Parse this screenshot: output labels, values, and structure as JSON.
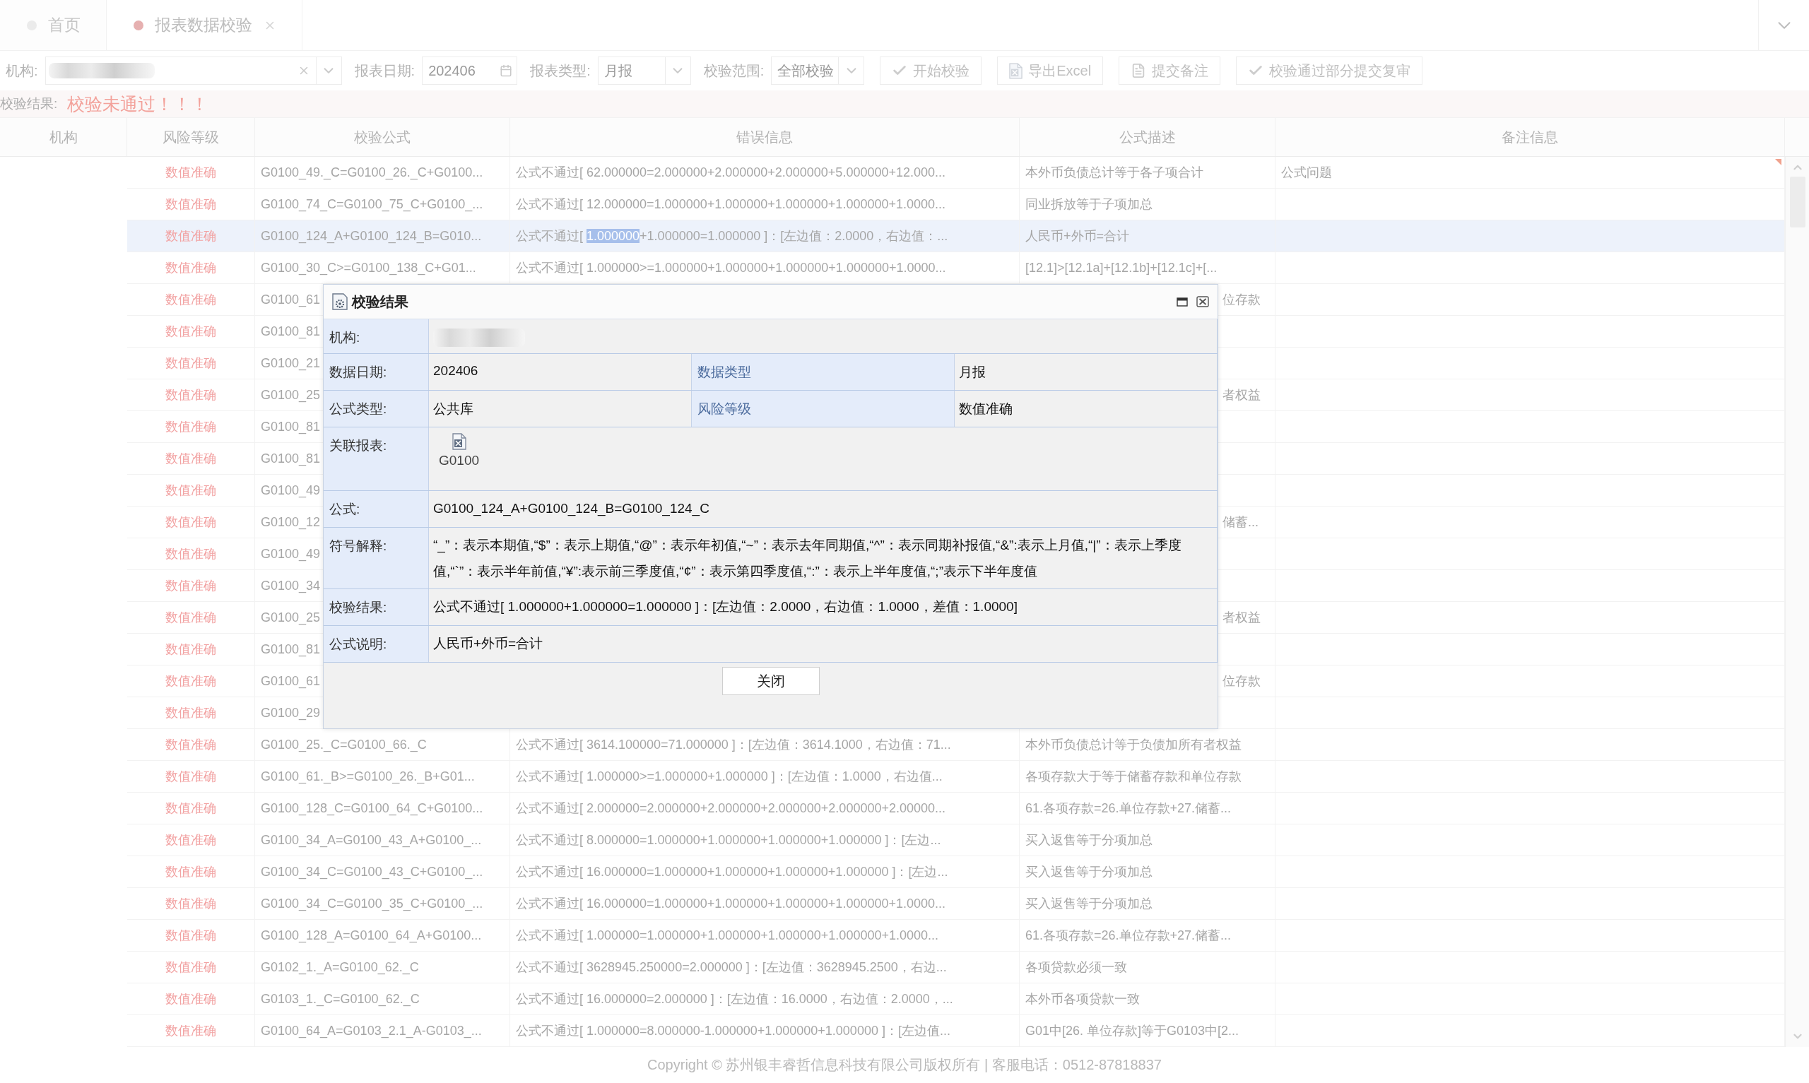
{
  "tabs": [
    {
      "label": "首页",
      "selected": false,
      "closable": false
    },
    {
      "label": "报表数据校验",
      "selected": true,
      "closable": true
    }
  ],
  "toolbar": {
    "fields": [
      {
        "kind": "combo",
        "label": "机构:"
      },
      {
        "kind": "date",
        "label": "报表日期:",
        "value": "202406"
      },
      {
        "kind": "select",
        "label": "报表类型:",
        "value": "月报"
      },
      {
        "kind": "select",
        "label": "校验范围:",
        "value": "全部校验"
      }
    ],
    "buttons": [
      {
        "kind": "check",
        "label": "开始校验"
      },
      {
        "kind": "excel",
        "label": "导出Excel"
      },
      {
        "kind": "note",
        "label": "提交备注"
      },
      {
        "kind": "check",
        "label": "校验通过部分提交复审"
      }
    ]
  },
  "result": {
    "label": "校验结果:",
    "message": "校验未通过！！！"
  },
  "table": {
    "columns": [
      "机构",
      "风险等级",
      "校验公式",
      "错误信息",
      "公式描述",
      "备注信息"
    ],
    "rows": [
      {
        "kind": "full",
        "risk": "数值准确",
        "formula": "G0100_49._C=G0100_26._C+G0100...",
        "error": "公式不通过[ 62.000000=2.000000+2.000000+2.000000+5.000000+12.000...",
        "description": "本外币负债总计等于各子项合计",
        "remark": "公式问题",
        "commented": true,
        "selected": false
      },
      {
        "kind": "full",
        "risk": "数值准确",
        "formula": "G0100_74_C=G0100_75_C+G0100_...",
        "error": "公式不通过[ 12.000000=1.000000+1.000000+1.000000+1.000000+1.0000...",
        "description": "同业拆放等于子项加总",
        "commented": false,
        "selected": false
      },
      {
        "kind": "full",
        "risk": "数值准确",
        "formula": "G0100_124_A+G0100_124_B=G010...",
        "error": [
          {
            "text": "公式不通过[ ",
            "selected": false
          },
          {
            "text": "1.000000",
            "selected": true
          },
          {
            "text": "+1.000000=1.000000 ]：[左边值：2.0000，右边值：...",
            "selected": false
          }
        ],
        "description": "人民币+外币=合计",
        "commented": false,
        "selected": true
      },
      {
        "kind": "full",
        "risk": "数值准确",
        "formula": "G0100_30_C>=G0100_138_C+G01...",
        "error": "公式不通过[ 1.000000>=1.000000+1.000000+1.000000+1.000000+1.0000...",
        "description": "[12.1]>[12.1a]+[12.1b]+[12.1c]+[...",
        "commented": false,
        "selected": false
      },
      {
        "kind": "covered",
        "risk": "数值准确",
        "formula": "G0100_61",
        "description": "位存款",
        "commented": false,
        "selected": false
      },
      {
        "kind": "covered",
        "risk": "数值准确",
        "formula": "G0100_81",
        "commented": false,
        "selected": false
      },
      {
        "kind": "covered",
        "risk": "数值准确",
        "formula": "G0100_21",
        "commented": false,
        "selected": false
      },
      {
        "kind": "covered",
        "risk": "数值准确",
        "formula": "G0100_25",
        "description": "者权益",
        "commented": false,
        "selected": false
      },
      {
        "kind": "covered",
        "risk": "数值准确",
        "formula": "G0100_81",
        "commented": false,
        "selected": false
      },
      {
        "kind": "covered",
        "risk": "数值准确",
        "formula": "G0100_81",
        "commented": false,
        "selected": false
      },
      {
        "kind": "covered",
        "risk": "数值准确",
        "formula": "G0100_49",
        "commented": false,
        "selected": false
      },
      {
        "kind": "covered",
        "risk": "数值准确",
        "formula": "G0100_12",
        "description": "储蓄...",
        "commented": false,
        "selected": false
      },
      {
        "kind": "covered",
        "risk": "数值准确",
        "formula": "G0100_49",
        "commented": false,
        "selected": false
      },
      {
        "kind": "covered",
        "risk": "数值准确",
        "formula": "G0100_34",
        "commented": false,
        "selected": false
      },
      {
        "kind": "covered",
        "risk": "数值准确",
        "formula": "G0100_25",
        "description": "者权益",
        "commented": false,
        "selected": false
      },
      {
        "kind": "covered",
        "risk": "数值准确",
        "formula": "G0100_81",
        "commented": false,
        "selected": false
      },
      {
        "kind": "covered",
        "risk": "数值准确",
        "formula": "G0100_61",
        "description": "位存款",
        "commented": false,
        "selected": false
      },
      {
        "kind": "covered",
        "risk": "数值准确",
        "formula": "G0100_29",
        "commented": false,
        "selected": false
      },
      {
        "kind": "full",
        "risk": "数值准确",
        "formula": "G0100_25._C=G0100_66._C",
        "error": "公式不通过[ 3614.100000=71.000000 ]：[左边值：3614.1000，右边值：71...",
        "description": "本外币负债总计等于负债加所有者权益",
        "commented": false,
        "selected": false
      },
      {
        "kind": "full",
        "risk": "数值准确",
        "formula": "G0100_61._B>=G0100_26._B+G01...",
        "error": "公式不通过[ 1.000000>=1.000000+1.000000 ]：[左边值：1.0000，右边值...",
        "description": "各项存款大于等于储蓄存款和单位存款",
        "commented": false,
        "selected": false
      },
      {
        "kind": "full",
        "risk": "数值准确",
        "formula": "G0100_128_C=G0100_64_C+G0100...",
        "error": "公式不通过[ 2.000000=2.000000+2.000000+2.000000+2.000000+2.00000...",
        "description": "61.各项存款=26.单位存款+27.储蓄...",
        "commented": false,
        "selected": false
      },
      {
        "kind": "full",
        "risk": "数值准确",
        "formula": "G0100_34_A=G0100_43_A+G0100_...",
        "error": "公式不通过[ 8.000000=1.000000+1.000000+1.000000+1.000000 ]：[左边...",
        "description": "买入返售等于分项加总",
        "commented": false,
        "selected": false
      },
      {
        "kind": "full",
        "risk": "数值准确",
        "formula": "G0100_34_C=G0100_43_C+G0100_...",
        "error": "公式不通过[ 16.000000=1.000000+1.000000+1.000000+1.000000 ]：[左边...",
        "description": "买入返售等于分项加总",
        "commented": false,
        "selected": false
      },
      {
        "kind": "full",
        "risk": "数值准确",
        "formula": "G0100_34_C=G0100_35_C+G0100_...",
        "error": "公式不通过[ 16.000000=1.000000+1.000000+1.000000+1.000000+1.0000...",
        "description": "买入返售等于分项加总",
        "commented": false,
        "selected": false
      },
      {
        "kind": "full",
        "risk": "数值准确",
        "formula": "G0100_128_A=G0100_64_A+G0100...",
        "error": "公式不通过[ 1.000000=1.000000+1.000000+1.000000+1.000000+1.0000...",
        "description": "61.各项存款=26.单位存款+27.储蓄...",
        "commented": false,
        "selected": false
      },
      {
        "kind": "full",
        "risk": "数值准确",
        "formula": "G0102_1._A=G0100_62._C",
        "error": "公式不通过[ 3628945.250000=2.000000 ]：[左边值：3628945.2500，右边...",
        "description": "各项贷款必须一致",
        "commented": false,
        "selected": false
      },
      {
        "kind": "full",
        "risk": "数值准确",
        "formula": "G0103_1._C=G0100_62._C",
        "error": "公式不通过[ 16.000000=2.000000 ]：[左边值：16.0000，右边值：2.0000，...",
        "description": "本外币各项贷款一致",
        "commented": false,
        "selected": false
      },
      {
        "kind": "full",
        "risk": "数值准确",
        "formula": "G0100_64_A=G0103_2.1_A-G0103_...",
        "error": "公式不通过[ 1.000000=8.000000-1.000000+1.000000+1.000000 ]：[左边值...",
        "description": "G01中[26. 单位存款]等于G0103中[2...",
        "commented": false,
        "selected": false
      }
    ]
  },
  "dialog": {
    "title": "校验结果",
    "rows": [
      {
        "kind": "blurred",
        "label": "机构:"
      },
      {
        "kind": "pair",
        "label": "数据日期:",
        "value": "202406",
        "label2": "数据类型",
        "value2": "月报"
      },
      {
        "kind": "pair",
        "label": "公式类型:",
        "value": "公共库",
        "label2": "风险等级",
        "value2": "数值准确"
      },
      {
        "kind": "report",
        "label": "关联报表:",
        "value": "G0100"
      },
      {
        "kind": "text",
        "label": "公式:",
        "value": "G0100_124_A+G0100_124_B=G0100_124_C"
      },
      {
        "kind": "text",
        "label": "符号解释:",
        "value": "“_”：表示本期值,“$”：表示上期值,“@”：表示年初值,“~”：表示去年同期值,“^”：表示同期补报值,“&”:表示上月值,“|”：表示上季度值,“`”：表示半年前值,“¥”:表示前三季度值,“¢”：表示第四季度值,“:”：表示上半年度值,“;”表示下半年度值"
      },
      {
        "kind": "text",
        "label": "校验结果:",
        "value": "公式不通过[ 1.000000+1.000000=1.000000 ]：[左边值：2.0000，右边值：1.0000，差值：1.0000]"
      },
      {
        "kind": "text",
        "label": "公式说明:",
        "value": "人民币+外币=合计"
      }
    ],
    "close_button": "关闭"
  },
  "footer": "Copyright © 苏州银丰睿哲信息科技有限公司版权所有 | 客服电话：0512-87818837"
}
